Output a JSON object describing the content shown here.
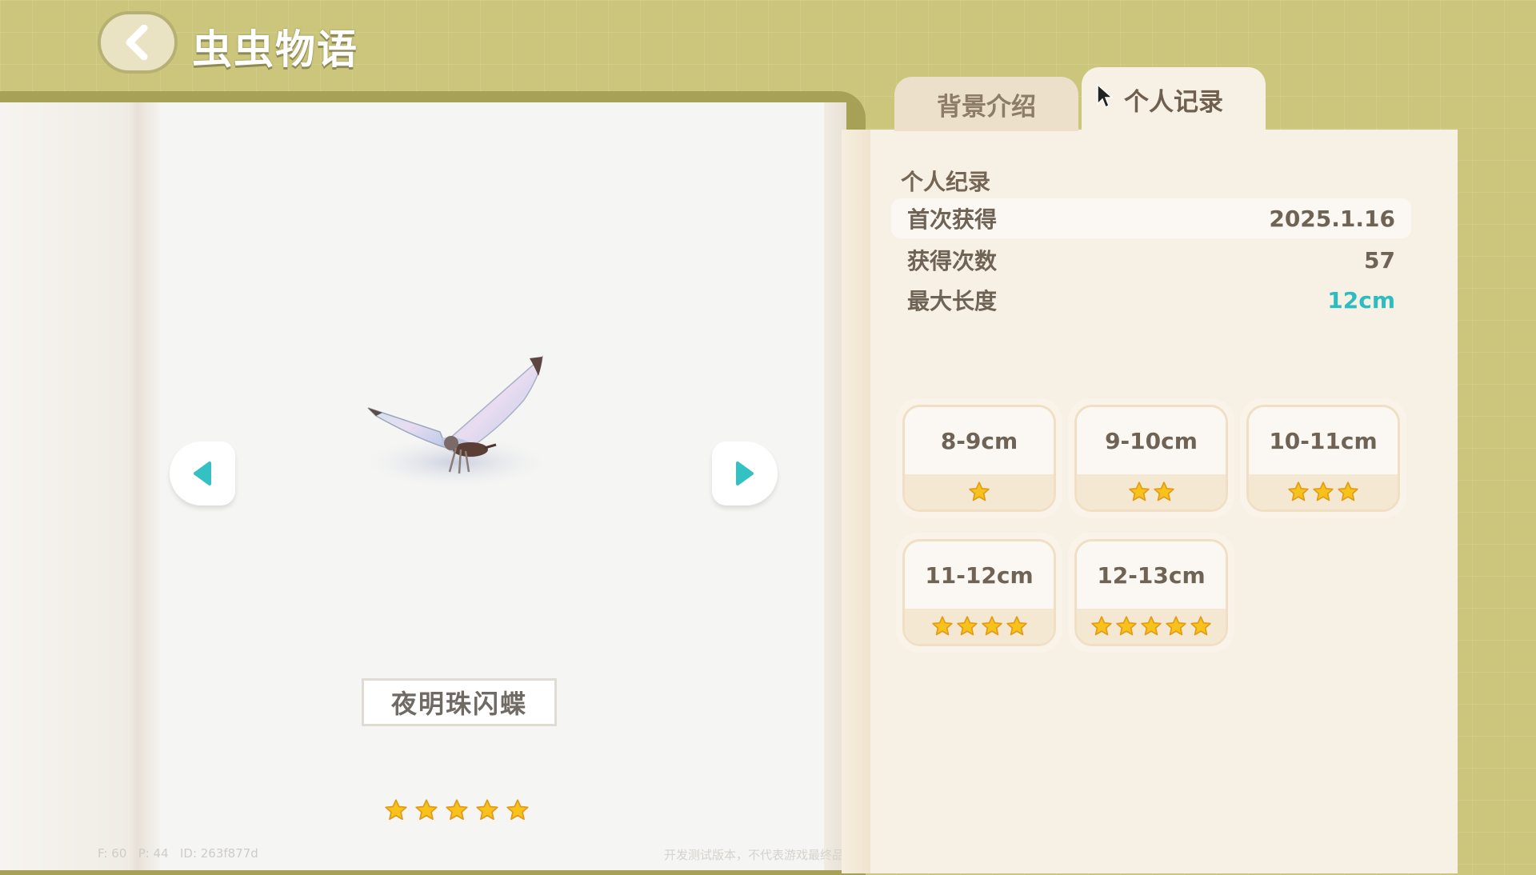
{
  "header": {
    "title": "虫虫物语",
    "back_icon": "chevron-left-icon"
  },
  "specimen": {
    "name": "夜明珠闪蝶",
    "rarity": 5,
    "image": "butterfly-model"
  },
  "tabs": [
    {
      "label": "背景介绍",
      "active": false
    },
    {
      "label": "个人记录",
      "active": true
    }
  ],
  "record": {
    "section_title": "个人纪录",
    "rows": [
      {
        "label": "首次获得",
        "value": "2025.1.16"
      },
      {
        "label": "获得次数",
        "value": "57"
      },
      {
        "label": "最大长度",
        "value": "12cm"
      }
    ]
  },
  "size_tiers": [
    {
      "label": "8-9cm",
      "stars": 1
    },
    {
      "label": "9-10cm",
      "stars": 2
    },
    {
      "label": "10-11cm",
      "stars": 3
    },
    {
      "label": "11-12cm",
      "stars": 4
    },
    {
      "label": "12-13cm",
      "stars": 5
    }
  ],
  "debug": {
    "fps": "F: 60",
    "ping": "P: 44",
    "id": "ID: 263f877d"
  },
  "disclaimer": "开发测试版本，不代表游戏最终品质",
  "colors": {
    "accent": "#2fbcc0",
    "star": "#f7c21b",
    "background": "#cbc67c"
  }
}
